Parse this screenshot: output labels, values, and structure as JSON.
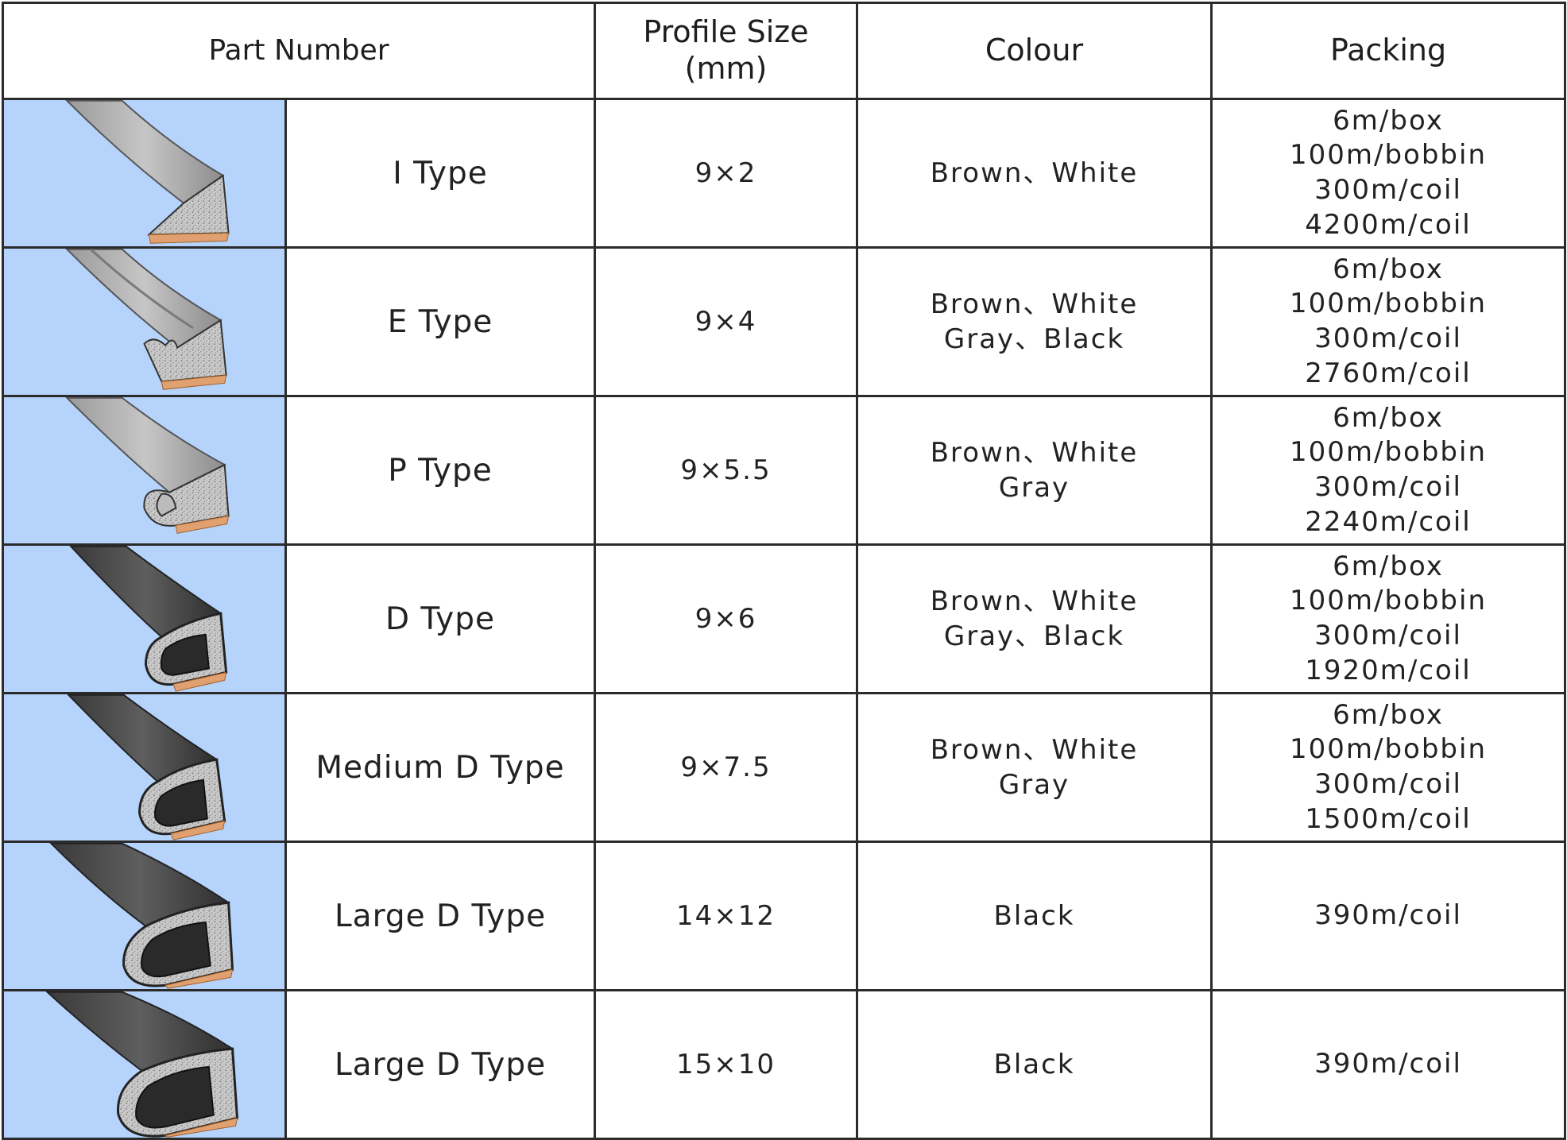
{
  "headers": {
    "part_number": "Part Number",
    "profile_size_line1": "Profile Size",
    "profile_size_line2": "(mm)",
    "colour": "Colour",
    "packing": "Packing"
  },
  "colors": {
    "image_background": "#b5d3fb",
    "border": "#2b2b2b",
    "foam_gray": "#c9c9c9",
    "profile_light": "#b8b8b8",
    "profile_dark": "#4a4a4a",
    "adhesive_tape": "#e0a070"
  },
  "rows": [
    {
      "profile_icon": "i-type-profile-icon",
      "type": "I Type",
      "size": "9×2",
      "colour": [
        "Brown、White"
      ],
      "packing": [
        "6m/box",
        "100m/bobbin",
        "300m/coil",
        "4200m/coil"
      ]
    },
    {
      "profile_icon": "e-type-profile-icon",
      "type": "E Type",
      "size": "9×4",
      "colour": [
        "Brown、White",
        "Gray、Black"
      ],
      "packing": [
        "6m/box",
        "100m/bobbin",
        "300m/coil",
        "2760m/coil"
      ]
    },
    {
      "profile_icon": "p-type-profile-icon",
      "type": "P Type",
      "size": "9×5.5",
      "colour": [
        "Brown、White",
        "Gray"
      ],
      "packing": [
        "6m/box",
        "100m/bobbin",
        "300m/coil",
        "2240m/coil"
      ]
    },
    {
      "profile_icon": "d-type-profile-icon",
      "type": "D Type",
      "size": "9×6",
      "colour": [
        "Brown、White",
        "Gray、Black"
      ],
      "packing": [
        "6m/box",
        "100m/bobbin",
        "300m/coil",
        "1920m/coil"
      ]
    },
    {
      "profile_icon": "medium-d-type-profile-icon",
      "type": "Medium D Type",
      "size": "9×7.5",
      "colour": [
        "Brown、White",
        "Gray"
      ],
      "packing": [
        "6m/box",
        "100m/bobbin",
        "300m/coil",
        "1500m/coil"
      ]
    },
    {
      "profile_icon": "large-d-type-profile-icon",
      "type": "Large D Type",
      "size": "14×12",
      "colour": [
        "Black"
      ],
      "packing": [
        "390m/coil"
      ]
    },
    {
      "profile_icon": "large-d-type-profile-icon",
      "type": "Large D Type",
      "size": "15×10",
      "colour": [
        "Black"
      ],
      "packing": [
        "390m/coil"
      ]
    }
  ]
}
